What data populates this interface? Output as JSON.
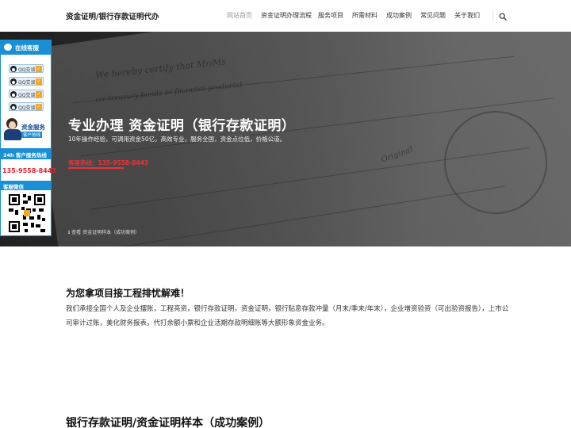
{
  "header": {
    "site_title": "资金证明/银行存款证明代办",
    "nav": [
      {
        "label": "网站首页",
        "active": true
      },
      {
        "label": "资金证明办理流程",
        "active": false
      },
      {
        "label": "服务项目",
        "active": false
      },
      {
        "label": "所需材料",
        "active": false
      },
      {
        "label": "成功案例",
        "active": false
      },
      {
        "label": "常见问题",
        "active": false
      },
      {
        "label": "关于我们",
        "active": false
      }
    ],
    "search_icon": "search-icon"
  },
  "hero": {
    "title": "专业办理 资金证明（银行存款证明）",
    "subtitle": "10年操作经验，可调用资金50亿，高效专业，服务全国，资金点位低，价格公道。",
    "hotline": "客服热线：135-9558-8443",
    "caption": "ℹ 查看 资金证明样本（成功案例）"
  },
  "service_panel": {
    "header": "在线客服",
    "qq_buttons": [
      "QQ交谈",
      "QQ交谈",
      "QQ交谈",
      "QQ交谈"
    ],
    "agent_title": "资金服务",
    "agent_tag": "客户热线",
    "hotline_label": "24h 客户服务热线",
    "phone": "135-9558-8443",
    "wechat_label": "客服微信"
  },
  "intro": {
    "title": "为您拿项目接工程排忧解难！",
    "body": "我们承接全国个人及企业摆账，工程亮资，银行存款证明，资金证明，银行贴息存款冲量（月末/季末/年末），企业增资验资（可出验资报告），上市公司审计过账，美化财务报表，代打余额小票和企业活期存款明细账等大额形象资金业务。"
  },
  "samples": {
    "title": "银行存款证明/资金证明样本（成功案例）"
  },
  "colors": {
    "accent_blue": "#1a8fd6",
    "hotline_red": "#e8333a"
  }
}
